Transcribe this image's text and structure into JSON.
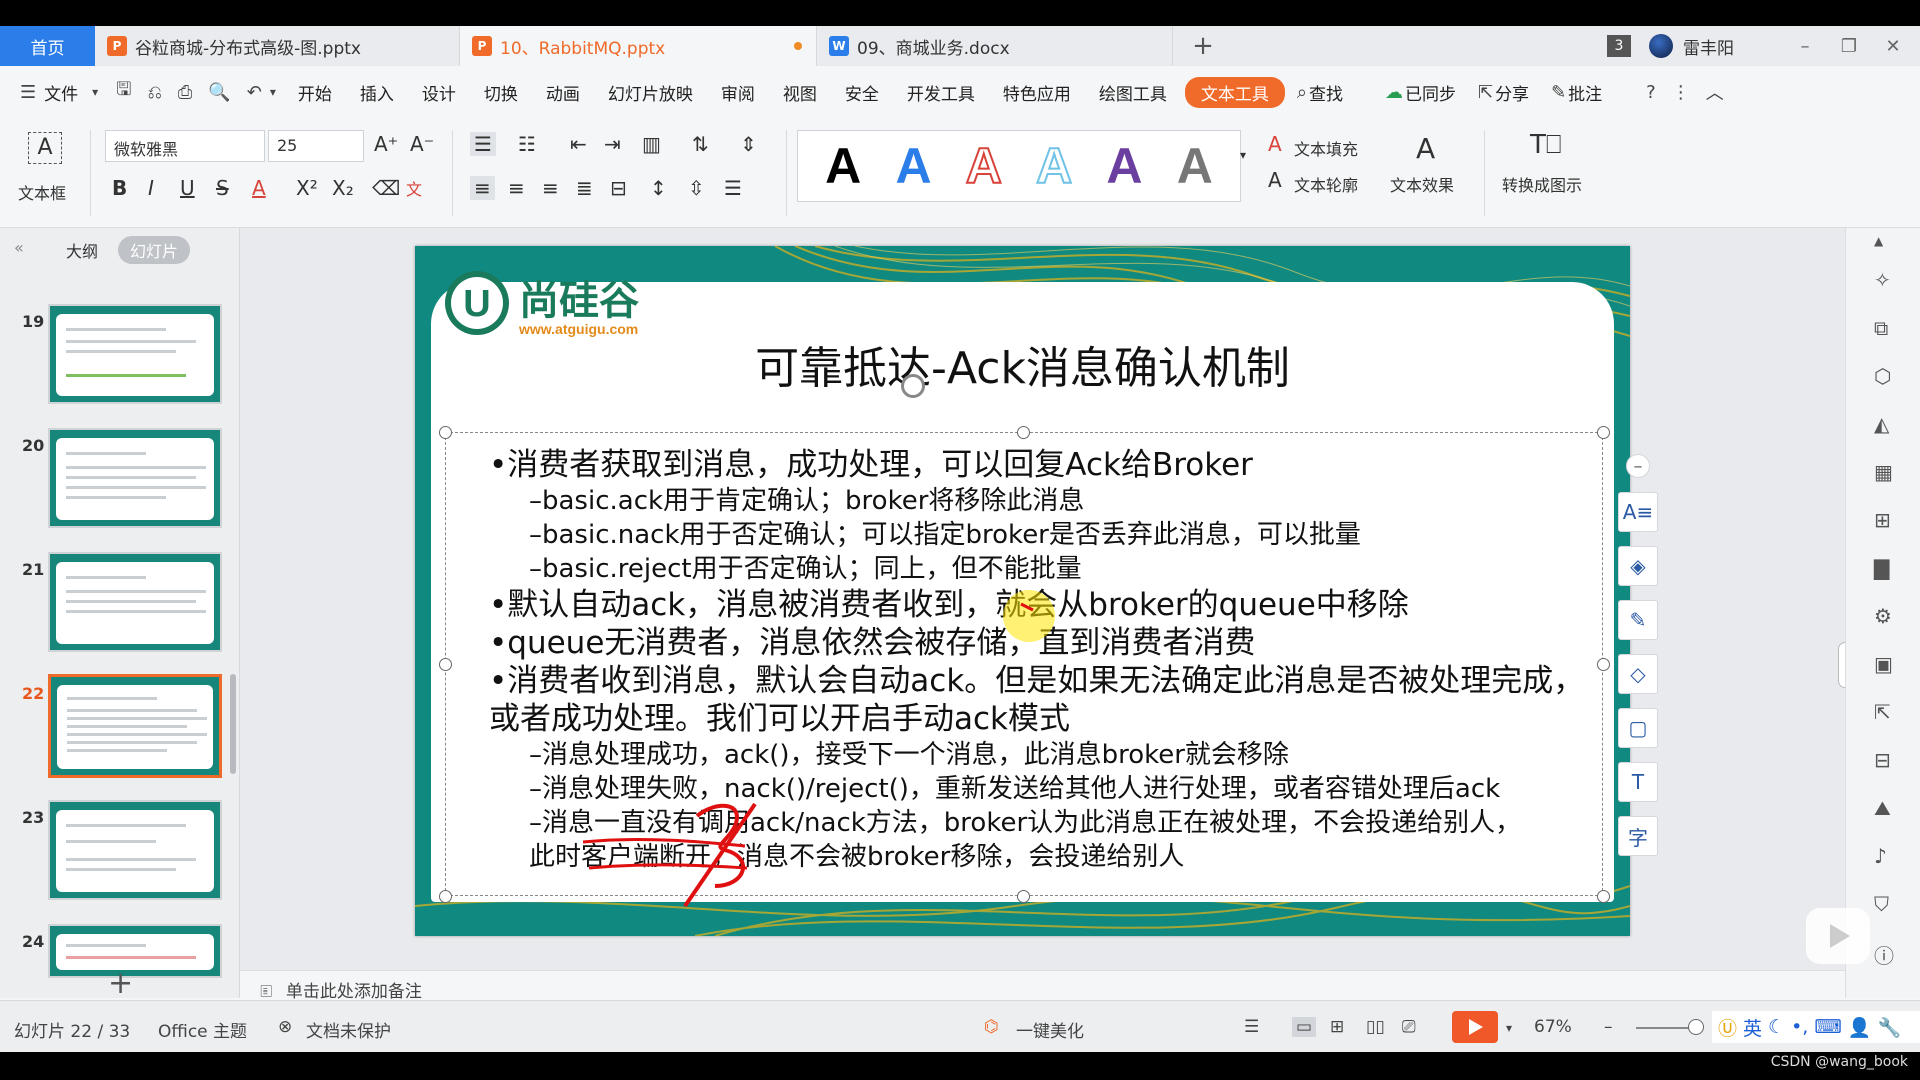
{
  "tabs": {
    "home": "首页",
    "docs": [
      {
        "label": "谷粒商城-分布式高级-图.pptx",
        "icon": "P",
        "color": "#f06a2a"
      },
      {
        "label": "10、RabbitMQ.pptx",
        "icon": "P",
        "color": "#f06a2a"
      },
      {
        "label": "09、商城业务.docx",
        "icon": "W",
        "color": "#2b7de9"
      }
    ],
    "new_tab": "+",
    "count_badge": "3",
    "user": "雷丰阳"
  },
  "menu": {
    "file": "文件",
    "items": [
      "开始",
      "插入",
      "设计",
      "切换",
      "动画",
      "幻灯片放映",
      "审阅",
      "视图",
      "安全",
      "开发工具",
      "特色应用",
      "绘图工具"
    ],
    "active": "文本工具",
    "search": "查找",
    "sync": "已同步",
    "share": "分享",
    "comment": "批注"
  },
  "ribbon": {
    "textbox": "文本框",
    "font_name": "微软雅黑",
    "font_size": "25",
    "text_fill": "文本填充",
    "text_outline": "文本轮廓",
    "text_effect": "文本效果",
    "convert": "转换成图示",
    "style_colors": [
      "#000000",
      "#2b7de9",
      "#d8433a",
      "#6fc3e6",
      "#6b3fa0",
      "#555555"
    ],
    "style_glyph": "A"
  },
  "left_panel": {
    "tab_outline": "大纲",
    "tab_slides": "幻灯片",
    "thumbnails": [
      "19",
      "20",
      "21",
      "22",
      "23",
      "24"
    ],
    "selected": "22",
    "add": "+"
  },
  "slide": {
    "logo_text": "尚硅谷",
    "logo_url": "www.atguigu.com",
    "title": "可靠抵达-Ack消息确认机制",
    "lines": [
      {
        "level": 1,
        "text": "•消费者获取到消息，成功处理，可以回复Ack给Broker"
      },
      {
        "level": 2,
        "text": "–basic.ack用于肯定确认；broker将移除此消息"
      },
      {
        "level": 2,
        "text": "–basic.nack用于否定确认；可以指定broker是否丢弃此消息，可以批量"
      },
      {
        "level": 2,
        "text": "–basic.reject用于否定确认；同上，但不能批量"
      },
      {
        "level": 1,
        "text": "•默认自动ack，消息被消费者收到，就会从broker的queue中移除"
      },
      {
        "level": 1,
        "text": "•queue无消费者，消息依然会被存储，直到消费者消费"
      },
      {
        "level": 1,
        "text": "•消费者收到消息，默认会自动ack。但是如果无法确定此消息是否被处理完成，"
      },
      {
        "level": 1,
        "text": "或者成功处理。我们可以开启手动ack模式"
      },
      {
        "level": 2,
        "text": "–消息处理成功，ack()，接受下一个消息，此消息broker就会移除"
      },
      {
        "level": 2,
        "text": "–消息处理失败，nack()/reject()，重新发送给其他人进行处理，或者容错处理后ack"
      },
      {
        "level": 2,
        "text": "–消息一直没有调用ack/nack方法，broker认为此消息正在被处理，不会投递给别人，"
      },
      {
        "level": 2,
        "text": "此时客户端断开，消息不会被broker移除，会投递给别人"
      }
    ]
  },
  "notes_placeholder": "单击此处添加备注",
  "status": {
    "slide_counter": "幻灯片 22 / 33",
    "theme": "Office 主题",
    "protect": "文档未保护",
    "beautify": "一键美化",
    "zoom": "67%",
    "ime_lang": "英"
  },
  "watermark": "CSDN @wang_book"
}
